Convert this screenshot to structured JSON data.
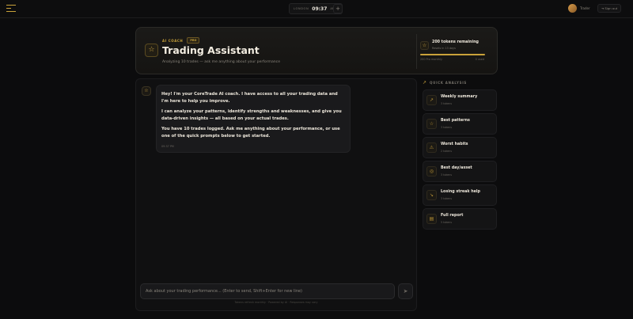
{
  "topbar": {
    "clock_city": "LONDON",
    "clock_time": "09:37",
    "clock_ampm": "AM",
    "add_label": "+",
    "user_name": "Trader",
    "exit_label": "⇥ Sign out"
  },
  "hero": {
    "coach_label": "AI COACH",
    "pro_label": "PRO",
    "title": "Trading Assistant",
    "subtitle": "Analyzing 10 trades — ask me anything about your performance",
    "tokens_title": "200 tokens remaining",
    "tokens_sub": "Resets in 13 days",
    "tokens_left": "200 Pro monthly",
    "tokens_right": "0 used",
    "tokens_fraction": 1.0
  },
  "chat": {
    "messages": [
      {
        "p1": "Hey! I'm your CoreTrade AI coach. I have access to all your trading data and I'm here to help you improve.",
        "p2": "I can analyze your patterns, identify strengths and weaknesses, and give you data-driven insights — all based on your actual trades.",
        "p3": "You have 10 trades logged. Ask me anything about your performance, or use one of the quick prompts below to get started.",
        "time": "09:37 PM"
      }
    ],
    "input_placeholder": "Ask about your trading performance... (Enter to send, Shift+Enter for new line)",
    "hint": "Tokens refresh monthly · Powered by AI · Responses may vary"
  },
  "quick_analysis": {
    "label": "QUICK ANALYSIS",
    "items": [
      {
        "title": "Weekly summary",
        "sub": "3 tokens",
        "icon": "trend-icon"
      },
      {
        "title": "Best patterns",
        "sub": "3 tokens",
        "icon": "star-icon"
      },
      {
        "title": "Worst habits",
        "sub": "2 tokens",
        "icon": "warning-icon"
      },
      {
        "title": "Best day/asset",
        "sub": "3 tokens",
        "icon": "target-icon"
      },
      {
        "title": "Losing streak help",
        "sub": "3 tokens",
        "icon": "down-trend-icon"
      },
      {
        "title": "Full report",
        "sub": "5 tokens",
        "icon": "document-icon"
      }
    ]
  },
  "colors": {
    "accent": "#c9a23a",
    "background": "#0c0c0d"
  }
}
